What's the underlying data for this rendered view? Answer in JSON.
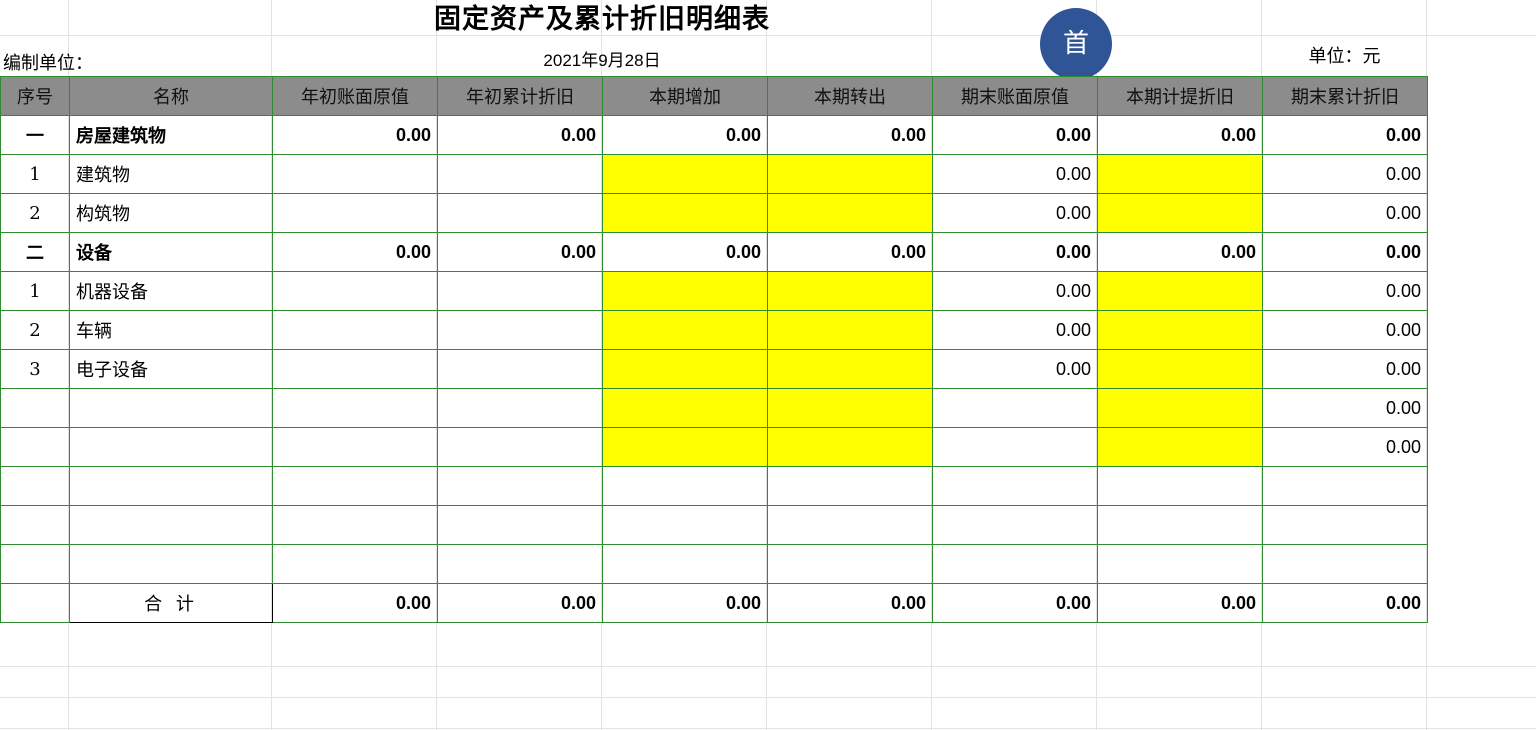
{
  "title": "固定资产及累计折旧明细表",
  "org_label": "编制单位：",
  "date": "2021年9月28日",
  "unit_label": "单位：元",
  "home_button_label": "首",
  "colors": {
    "header_bg": "#8c8c8c",
    "border": "#2e8b2e",
    "input_fill": "#ffff00",
    "home_button": "#2f5597"
  },
  "columns": [
    "序号",
    "名称",
    "年初账面原值",
    "年初累计折旧",
    "本期增加",
    "本期转出",
    "期末账面原值",
    "本期计提折旧",
    "期末累计折旧"
  ],
  "rows": [
    {
      "idx": "一",
      "name": "房屋建筑物",
      "bold": true,
      "vals": [
        "0.00",
        "0.00",
        "0.00",
        "0.00",
        "0.00",
        "0.00",
        "0.00"
      ]
    },
    {
      "idx": "1",
      "name": "建筑物",
      "bold": false,
      "vals": [
        "",
        "",
        "",
        "",
        "0.00",
        "",
        "0.00"
      ]
    },
    {
      "idx": "2",
      "name": "构筑物",
      "bold": false,
      "vals": [
        "",
        "",
        "",
        "",
        "0.00",
        "",
        "0.00"
      ]
    },
    {
      "idx": "二",
      "name": "设备",
      "bold": true,
      "vals": [
        "0.00",
        "0.00",
        "0.00",
        "0.00",
        "0.00",
        "0.00",
        "0.00"
      ]
    },
    {
      "idx": "1",
      "name": "机器设备",
      "bold": false,
      "vals": [
        "",
        "",
        "",
        "",
        "0.00",
        "",
        "0.00"
      ]
    },
    {
      "idx": "2",
      "name": "车辆",
      "bold": false,
      "vals": [
        "",
        "",
        "",
        "",
        "0.00",
        "",
        "0.00"
      ]
    },
    {
      "idx": "3",
      "name": "电子设备",
      "bold": false,
      "vals": [
        "",
        "",
        "",
        "",
        "0.00",
        "",
        "0.00"
      ]
    },
    {
      "idx": "",
      "name": "",
      "bold": false,
      "vals": [
        "",
        "",
        "",
        "",
        "",
        "",
        "0.00"
      ]
    },
    {
      "idx": "",
      "name": "",
      "bold": false,
      "vals": [
        "",
        "",
        "",
        "",
        "",
        "",
        "0.00"
      ]
    },
    {
      "idx": "",
      "name": "",
      "bold": false,
      "vals": [
        "",
        "",
        "",
        "",
        "",
        "",
        ""
      ]
    },
    {
      "idx": "",
      "name": "",
      "bold": false,
      "vals": [
        "",
        "",
        "",
        "",
        "",
        "",
        ""
      ]
    },
    {
      "idx": "",
      "name": "",
      "bold": false,
      "vals": [
        "",
        "",
        "",
        "",
        "",
        "",
        ""
      ]
    }
  ],
  "total": {
    "label": "合 计",
    "vals": [
      "0.00",
      "0.00",
      "0.00",
      "0.00",
      "0.00",
      "0.00",
      "0.00"
    ]
  }
}
